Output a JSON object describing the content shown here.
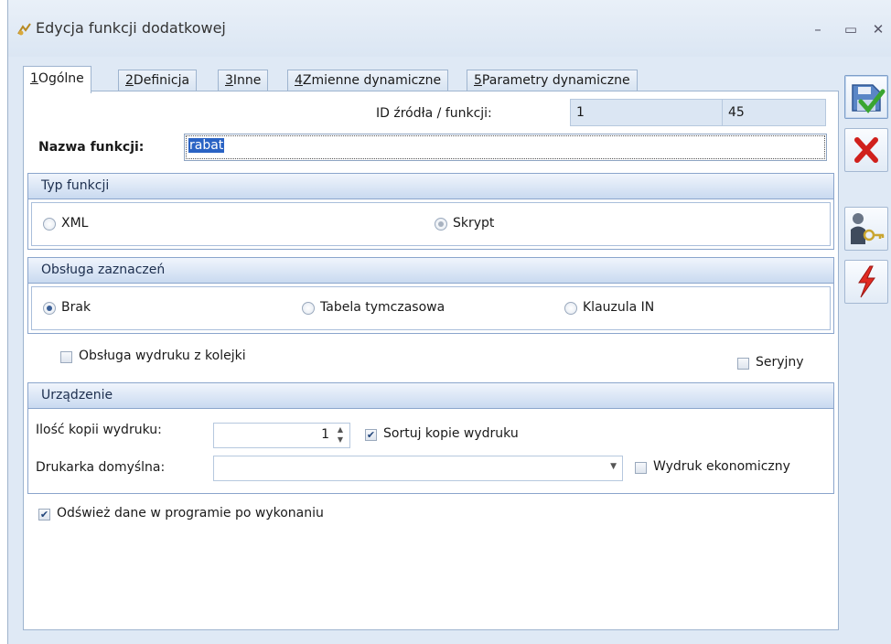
{
  "window": {
    "title": "Edycja funkcji dodatkowej",
    "minimize_glyph": "–",
    "maximize_glyph": "▭",
    "close_glyph": "✕",
    "app_icon": "function-icon"
  },
  "tabs": [
    {
      "key": "1",
      "label": "Ogólne",
      "active": true
    },
    {
      "key": "2",
      "label": "Definicja",
      "active": false
    },
    {
      "key": "3",
      "label": "Inne",
      "active": false
    },
    {
      "key": "4",
      "label": "Zmienne dynamiczne",
      "active": false
    },
    {
      "key": "5",
      "label": "Parametry dynamiczne",
      "active": false
    }
  ],
  "id_row": {
    "label": "ID źródła / funkcji:",
    "source_id": "1",
    "separator": "/",
    "function_id": "45"
  },
  "name": {
    "label": "Nazwa funkcji:",
    "value": "rabat"
  },
  "typ_funkcji": {
    "title": "Typ funkcji",
    "options": [
      {
        "label": "XML",
        "selected": false
      },
      {
        "label": "Skrypt",
        "selected": true
      }
    ]
  },
  "obsluga_zaznaczen": {
    "title": "Obsługa zaznaczeń",
    "options": [
      {
        "label": "Brak",
        "selected": true
      },
      {
        "label": "Tabela tymczasowa",
        "selected": false
      },
      {
        "label": "Klauzula IN",
        "selected": false
      }
    ]
  },
  "queue_print": {
    "label": "Obsługa wydruku z kolejki",
    "checked": false
  },
  "serial": {
    "label": "Seryjny",
    "checked": false
  },
  "urzadzenie": {
    "title": "Urządzenie",
    "copies_label": "Ilość kopii wydruku:",
    "copies_value": "1",
    "sort_label": "Sortuj kopie wydruku",
    "sort_checked": true,
    "printer_label": "Drukarka domyślna:",
    "printer_value": "",
    "economy_label": "Wydruk ekonomiczny",
    "economy_checked": false
  },
  "refresh": {
    "label": "Odśwież dane w programie po wykonaniu",
    "checked": true
  },
  "side_buttons": [
    {
      "name": "save-button",
      "icon": "save-check-icon"
    },
    {
      "name": "cancel-button",
      "icon": "red-x-icon"
    },
    {
      "name": "permissions-button",
      "icon": "person-key-icon"
    },
    {
      "name": "execute-button",
      "icon": "lightning-icon"
    }
  ],
  "colors": {
    "accent": "#2a63c4",
    "group_border": "#8aa5cc",
    "cancel_red": "#d0201c",
    "save_green": "#3aa531"
  }
}
